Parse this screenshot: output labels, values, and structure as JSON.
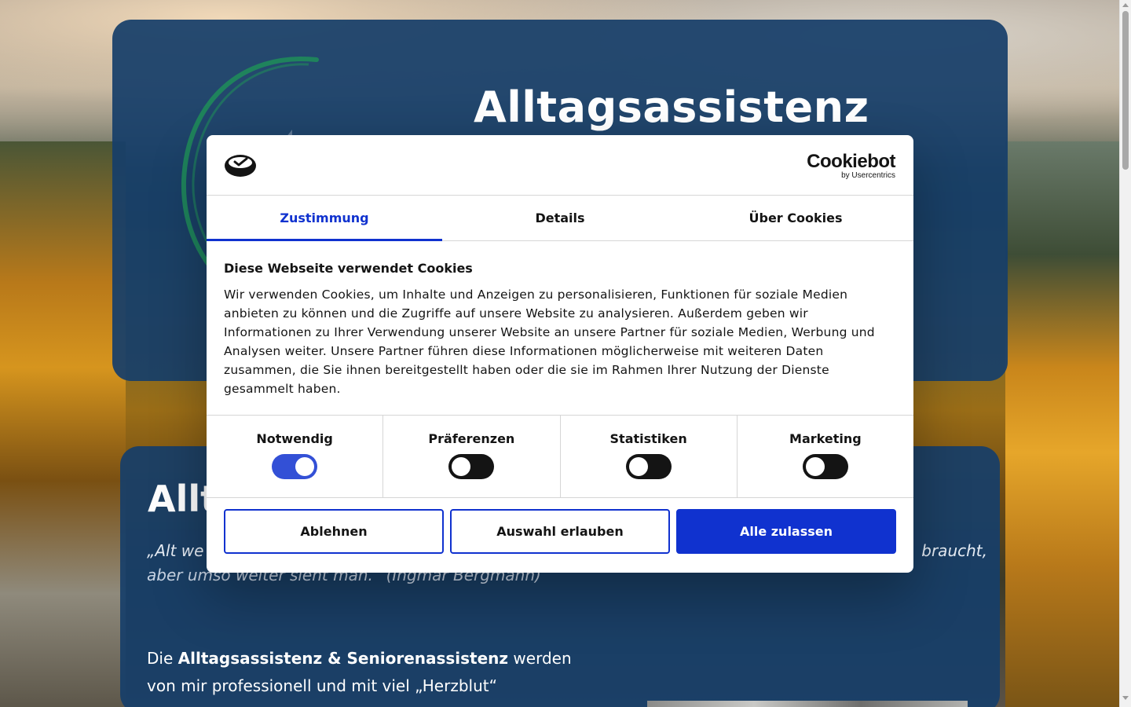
{
  "page": {
    "hero_title": "Alltagsassistenz",
    "content_heading": "Allt",
    "quote_text": "„Alt we",
    "quote_right": "braucht,",
    "quote_line2": "aber umso weiter sieht man.“ (Ingmar Bergmann)",
    "intro_before": "Die ",
    "intro_bold": "Alltagsassistenz & Seniorenassistenz",
    "intro_after": " werden von mir professionell und mit viel „Herzblut“"
  },
  "cookie_dialog": {
    "provider_name": "Cookiebot",
    "provider_sub": "by Usercentrics",
    "tabs": [
      {
        "label": "Zustimmung",
        "active": true
      },
      {
        "label": "Details",
        "active": false
      },
      {
        "label": "Über Cookies",
        "active": false
      }
    ],
    "title": "Diese Webseite verwendet Cookies",
    "text": "Wir verwenden Cookies, um Inhalte und Anzeigen zu personalisieren, Funktionen für soziale Medien anbieten zu können und die Zugriffe auf unsere Website zu analysieren. Außerdem geben wir Informationen zu Ihrer Verwendung unserer Website an unsere Partner für soziale Medien, Werbung und Analysen weiter. Unsere Partner führen diese Informationen möglicherweise mit weiteren Daten zusammen, die Sie ihnen bereitgestellt haben oder die sie im Rahmen Ihrer Nutzung der Dienste gesammelt haben.",
    "toggles": [
      {
        "label": "Notwendig",
        "checked": true
      },
      {
        "label": "Präferenzen",
        "checked": false
      },
      {
        "label": "Statistiken",
        "checked": false
      },
      {
        "label": "Marketing",
        "checked": false
      }
    ],
    "buttons": {
      "decline": "Ablehnen",
      "allow_selection": "Auswahl erlauben",
      "allow_all": "Alle zulassen"
    },
    "colors": {
      "accent": "#1032cf",
      "card": "#173e69"
    }
  },
  "icons": {
    "brand": "cookie-brand-icon",
    "scroll_up": "scroll-up-icon",
    "scroll_down": "scroll-down-icon"
  }
}
